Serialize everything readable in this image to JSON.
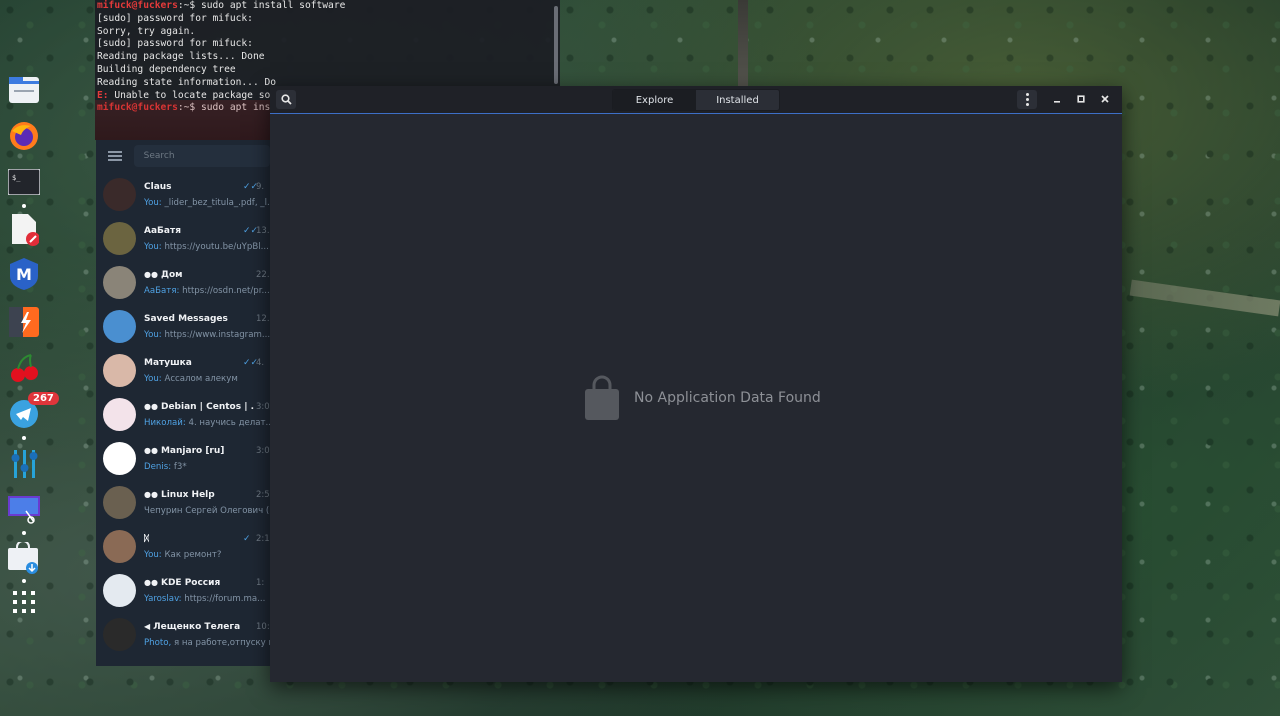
{
  "terminal": {
    "lines": [
      {
        "user": "mifuck@fuckers",
        "prompt_rest": ":~$ sudo apt install software"
      },
      {
        "text": "[sudo] password for mifuck:"
      },
      {
        "text": "Sorry, try again."
      },
      {
        "text": "[sudo] password for mifuck:"
      },
      {
        "text": "Reading package lists... Done"
      },
      {
        "text": "Building dependency tree"
      },
      {
        "text": "Reading state information... Do"
      },
      {
        "err": "E:",
        "text": " Unable to locate package so"
      },
      {
        "user": "mifuck@fuckers",
        "prompt_rest": ":~$ sudo apt ins"
      }
    ]
  },
  "dock": {
    "items": [
      {
        "name": "files-icon"
      },
      {
        "name": "firefox-icon"
      },
      {
        "name": "terminal-icon",
        "label": "$_"
      },
      {
        "name": "text-editor-icon"
      },
      {
        "name": "malwarebytes-icon",
        "label": "M"
      },
      {
        "name": "sublime-icon"
      },
      {
        "name": "cherry-icon"
      },
      {
        "name": "telegram-icon",
        "badge": "267"
      },
      {
        "name": "mixer-icon"
      },
      {
        "name": "screenshot-tool-icon"
      },
      {
        "name": "software-center-icon"
      },
      {
        "name": "app-grid-icon"
      }
    ]
  },
  "telegram": {
    "search_placeholder": "Search",
    "chats": [
      {
        "name": "Claus",
        "time": "9.",
        "who": "You:",
        "msg": " _lider_bez_titula_.pdf, _l.",
        "checks": "✓✓",
        "avatar": "#3a2a2a"
      },
      {
        "name": "АаБатя",
        "time": "13.",
        "who": "You:",
        "msg": " https://youtu.be/uYpBl...",
        "checks": "✓✓",
        "avatar": "#6b6440"
      },
      {
        "name": "Дом",
        "time": "22.",
        "who": "АаБатя:",
        "msg": " https://osdn.net/pr...",
        "group": true,
        "avatar": "#8a8478"
      },
      {
        "name": "Saved Messages",
        "time": "12.",
        "who": "You:",
        "msg": " https://www.instagram...",
        "avatar": "#4a8fd0"
      },
      {
        "name": "Матушка",
        "time": "4.",
        "who": "You:",
        "msg": " Ассалом алекум",
        "checks": "✓✓",
        "avatar": "#d9b8a8"
      },
      {
        "name": "Debian | Centos | ...",
        "time": "3:0",
        "who": "Николай:",
        "msg": " 4. научись делат...",
        "group": true,
        "avatar": "#f3e3ea"
      },
      {
        "name": "Manjaro [ru]",
        "time": "3:0",
        "who": "Denis:",
        "msg": " f3*",
        "group": true,
        "avatar": "#ffffff"
      },
      {
        "name": "Linux Help",
        "time": "2:5",
        "who": "",
        "msg": "Чепурин Сергей Олегович (",
        "group": true,
        "avatar": "#6a6050"
      },
      {
        "name": "ᛞ",
        "time": "2:1",
        "who": "You:",
        "msg": " Как ремонт?",
        "checks": "✓",
        "avatar": "#8a6a55"
      },
      {
        "name": "KDE Россия",
        "time": "1:",
        "who": "Yaroslav:",
        "msg": " https://forum.ma...",
        "group": true,
        "avatar": "#e4eaf0"
      },
      {
        "name": "Лещенко Телега",
        "time": "10:4",
        "who": "Photo,",
        "msg": " я на работе,отпуску г",
        "channel": true,
        "avatar": "#2a2a2a"
      }
    ]
  },
  "software": {
    "tab_explore": "Explore",
    "tab_installed": "Installed",
    "empty_message": "No Application Data Found"
  }
}
